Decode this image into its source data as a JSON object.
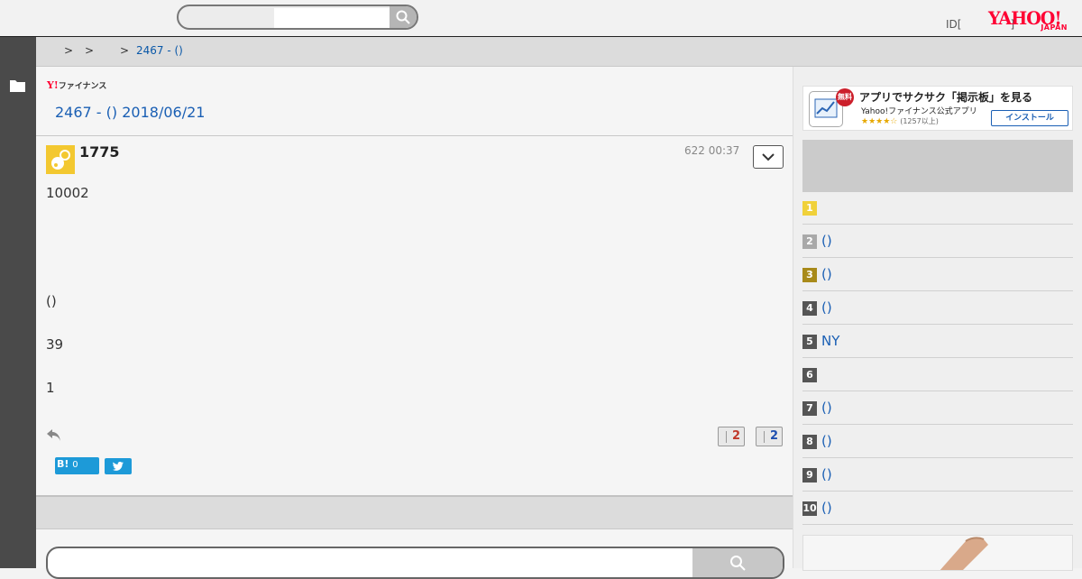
{
  "header": {
    "login_text": "ID[",
    "login_close": "]",
    "yahoo_logo_text": "YAHOO!",
    "yahoo_logo_sub": "JAPAN"
  },
  "breadcrumb": {
    "sep1": ">",
    "sep2": ">",
    "sep3": ">",
    "current": "2467 - ()"
  },
  "main": {
    "logo_y": "Y!",
    "logo_text": "ファイナンス",
    "thread_title": "2467 - () 2018/06/21",
    "post": {
      "poster": "1775",
      "time": "622 00:37",
      "lines": [
        "10002",
        "()",
        "39",
        "1"
      ],
      "vote_up": "2",
      "vote_down": "2",
      "hatena_label": "B!",
      "hatena_count": "0"
    }
  },
  "sidebar": {
    "banner": {
      "free_badge": "無料",
      "title": "アプリでサクサク「掲示板」を見る",
      "subtitle": "Yahoo!ファイナンス公式アプリ",
      "stars": "★★★★☆",
      "reviews": "(1257以上)",
      "install": "インストール"
    },
    "ranking": [
      {
        "num": "1",
        "text": "",
        "color": "#f0d13a"
      },
      {
        "num": "2",
        "text": "()",
        "color": "#a9a9a9"
      },
      {
        "num": "3",
        "text": "()",
        "color": "#a88a1a"
      },
      {
        "num": "4",
        "text": "()",
        "color": "#555555"
      },
      {
        "num": "5",
        "text": "NY",
        "color": "#555555"
      },
      {
        "num": "6",
        "text": "",
        "color": "#555555"
      },
      {
        "num": "7",
        "text": "()",
        "color": "#555555"
      },
      {
        "num": "8",
        "text": "()",
        "color": "#555555"
      },
      {
        "num": "9",
        "text": "()",
        "color": "#555555"
      },
      {
        "num": "10",
        "text": "()",
        "color": "#555555"
      }
    ]
  },
  "colors": {
    "link": "#1a5fb4",
    "up_vote": "#c0392b",
    "down_vote": "#1e4fb0",
    "share": "#1d9ad8",
    "yahoo_red": "#ff0033"
  }
}
